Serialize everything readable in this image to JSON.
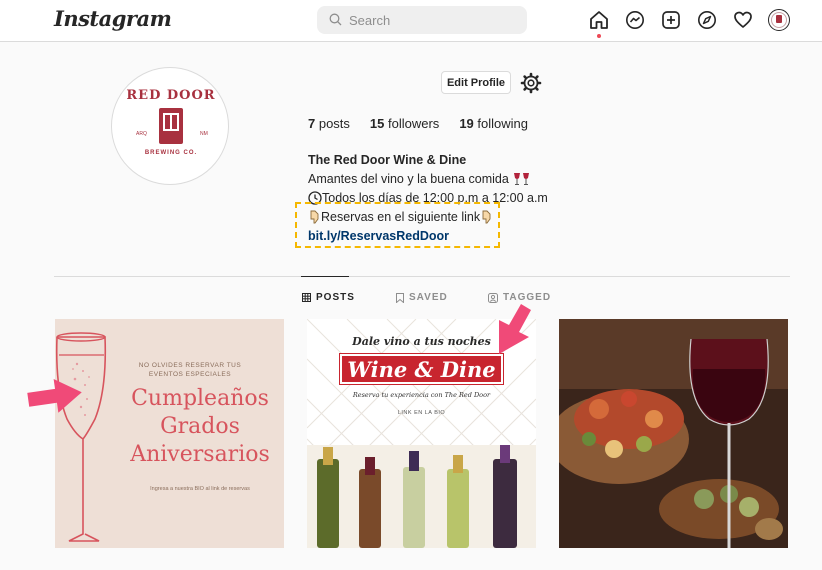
{
  "nav": {
    "logo": "Instagram",
    "search_placeholder": "Search",
    "icons": [
      "home-icon",
      "messenger-icon",
      "new-post-icon",
      "explore-icon",
      "activity-heart-icon",
      "profile-avatar"
    ]
  },
  "profile": {
    "avatar": {
      "title": "RED DOOR",
      "left": "ARQ",
      "right": "NM",
      "subtitle": "BREWING CO."
    },
    "edit_label": "Edit Profile",
    "stats": [
      {
        "count": "7",
        "label": " posts"
      },
      {
        "count": "15",
        "label": " followers"
      },
      {
        "count": "19",
        "label": " following"
      }
    ],
    "bio": {
      "name": "The Red Door Wine & Dine",
      "line1": "Amantes del vino y la buena comida ",
      "line2": "Todos los días de 12:00 p.m a 12:00 a.m",
      "line3": "Reservas en el siguiente link",
      "link": "bit.ly/ReservasRedDoor"
    }
  },
  "tabs": [
    {
      "label": "POSTS",
      "active": true
    },
    {
      "label": "SAVED",
      "active": false
    },
    {
      "label": "TAGGED",
      "active": false
    }
  ],
  "posts": {
    "post1": {
      "small": "NO OLVIDES RESERVAR TUS EVENTOS ESPECIALES",
      "lines": [
        "Cumpleaños",
        "Grados",
        "Aniversarios"
      ],
      "foot": "Ingresa a nuestra BIO al link de reservas"
    },
    "post2": {
      "top": "Dale vino a tus noches",
      "banner": "Wine & Dine",
      "sub": "Reserva tu experiencia con The Red Door",
      "link": "LINK EN LA BIO"
    }
  },
  "colors": {
    "accent_red": "#a8313f",
    "highlight": "#f5b800",
    "arrow_pink": "#f04a78"
  }
}
